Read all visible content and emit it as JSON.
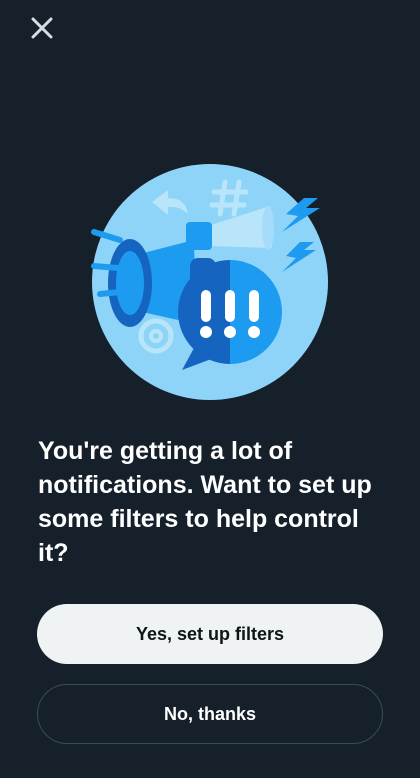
{
  "prompt": {
    "headline": "You're getting a lot of notifications. Want to set up some filters to help control it?",
    "primary_button_label": "Yes, set up filters",
    "secondary_button_label": "No, thanks"
  },
  "icons": {
    "close": "close-icon",
    "illustration": "notifications-illustration"
  },
  "colors": {
    "background": "#15202b",
    "primary_button_bg": "#eff3f4",
    "primary_button_text": "#0f1419",
    "secondary_button_border": "#3a4a58",
    "illustration_circle": "#8ed4f8",
    "accent_blue": "#1d9bf0"
  }
}
